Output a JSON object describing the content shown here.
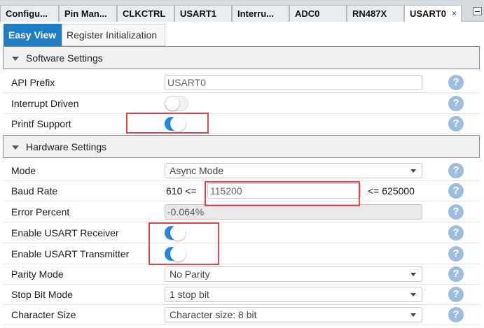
{
  "editor_tabs": [
    {
      "label": "Configu..."
    },
    {
      "label": "Pin Man..."
    },
    {
      "label": "CLKCTRL"
    },
    {
      "label": "USART1"
    },
    {
      "label": "Interru..."
    },
    {
      "label": "ADC0"
    },
    {
      "label": "RN487X"
    },
    {
      "label": "USART0",
      "close": "×"
    }
  ],
  "view_tabs": {
    "easy_view": "Easy View",
    "register_init": "Register Initialization"
  },
  "software_section": {
    "title": "Software Settings",
    "api_prefix": {
      "label": "API Prefix",
      "value": "USART0"
    },
    "interrupt_driven": {
      "label": "Interrupt Driven",
      "enabled": false
    },
    "printf_support": {
      "label": "Printf Support",
      "enabled": true
    }
  },
  "hardware_section": {
    "title": "Hardware Settings",
    "mode": {
      "label": "Mode",
      "value": "Async Mode"
    },
    "baud_rate": {
      "label": "Baud Rate",
      "min": "610 <=",
      "value": "115200",
      "max": "<= 625000"
    },
    "error_percent": {
      "label": "Error Percent",
      "value": "-0.064%"
    },
    "usart_receiver": {
      "label": "Enable USART Receiver",
      "enabled": true
    },
    "usart_transmitter": {
      "label": "Enable USART Transmitter",
      "enabled": true
    },
    "parity_mode": {
      "label": "Parity Mode",
      "value": "No Parity"
    },
    "stop_bit_mode": {
      "label": "Stop Bit Mode",
      "value": "1 stop bit"
    },
    "character_size": {
      "label": "Character Size",
      "value": "Character size: 8 bit"
    }
  },
  "help_glyph": "?",
  "colors": {
    "accent": "#1f7fc6",
    "toggle_on": "#1f88e5",
    "help": "#9bbde0",
    "annotation": "#e0474c"
  }
}
